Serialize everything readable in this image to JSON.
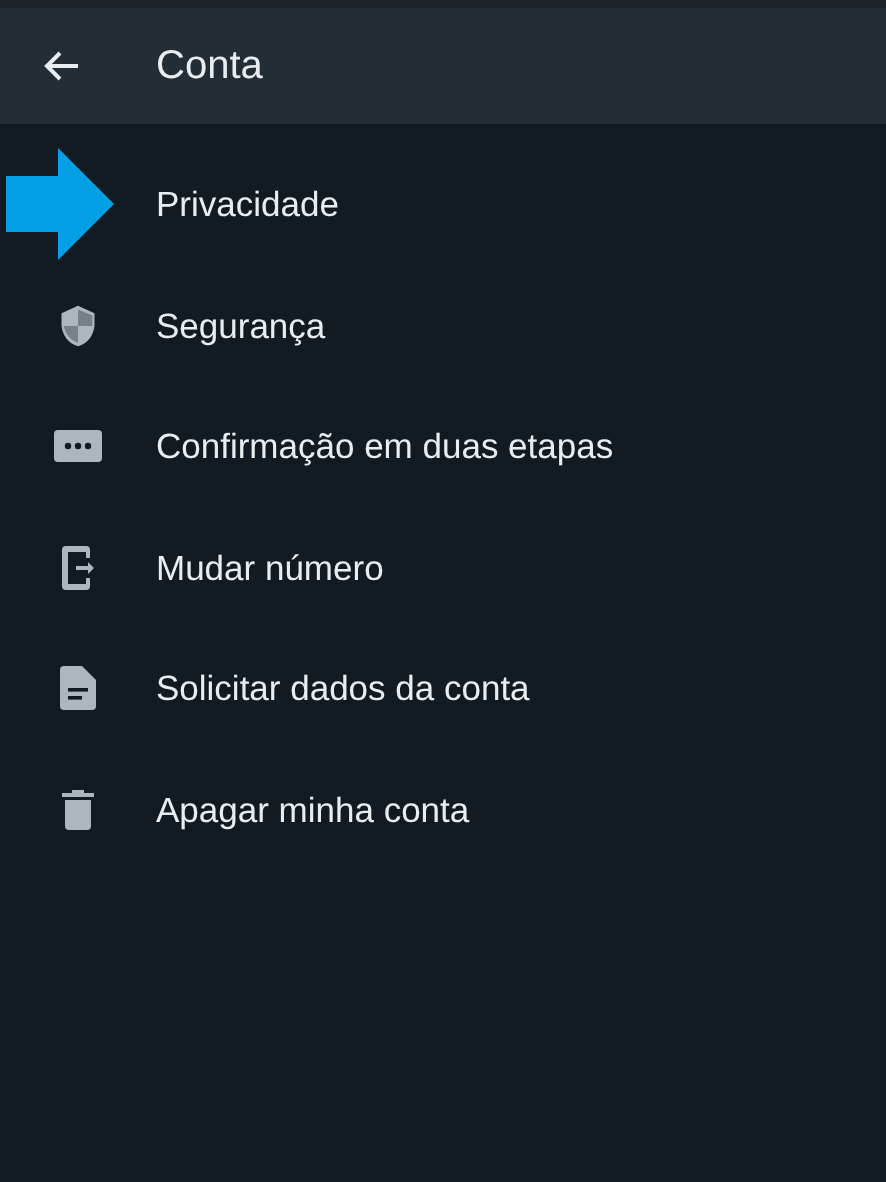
{
  "header": {
    "title": "Conta"
  },
  "items": [
    {
      "label": "Privacidade",
      "kind": "pointer"
    },
    {
      "label": "Segurança",
      "kind": "shield"
    },
    {
      "label": "Confirmação em duas etapas",
      "kind": "dots"
    },
    {
      "label": "Mudar número",
      "kind": "phone"
    },
    {
      "label": "Solicitar dados da conta",
      "kind": "document"
    },
    {
      "label": "Apagar minha conta",
      "kind": "trash"
    }
  ]
}
